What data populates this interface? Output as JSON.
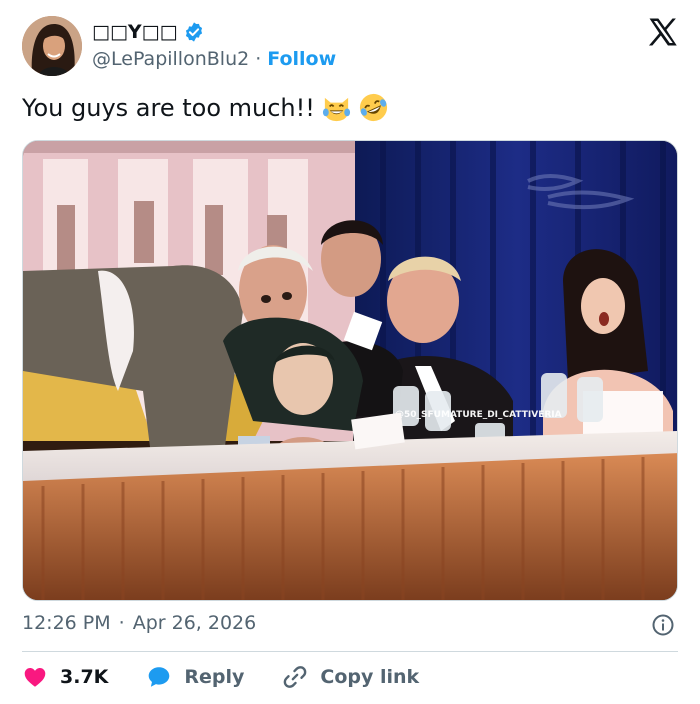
{
  "author": {
    "display_name": "□□Y□□",
    "handle": "@LePapillonBlu2",
    "separator": "·",
    "follow_label": "Follow",
    "verified": true
  },
  "tweet": {
    "text": "You guys are too much!!",
    "emojis": [
      "cat-tears-of-joy-emoji",
      "rolling-on-floor-laughing-emoji"
    ]
  },
  "media": {
    "watermark": "@50_SFUMATURE_DI_CATTIVERIA"
  },
  "meta": {
    "time": "12:26 PM",
    "separator": "·",
    "date": "Apr 26, 2026"
  },
  "actions": {
    "likes_count": "3.7K",
    "reply_label": "Reply",
    "copy_link_label": "Copy link"
  },
  "colors": {
    "accent": "#1d9bf0",
    "like": "#f91880",
    "muted": "#536471",
    "border": "#cfd9de"
  }
}
